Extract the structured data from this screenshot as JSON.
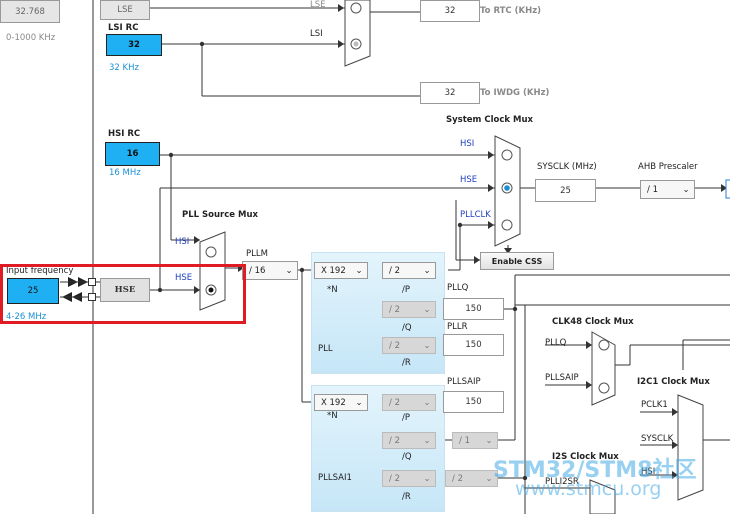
{
  "lse_label": "LSE",
  "lse_top_value": "32.768",
  "lse_range": "0-1000 KHz",
  "lsi_rc": {
    "title": "LSI RC",
    "value": "32",
    "unit": "32 KHz"
  },
  "rtc": {
    "value": "32",
    "label": "To RTC (KHz)"
  },
  "iwdg": {
    "value": "32",
    "label": "To IWDG (KHz)"
  },
  "hsi_rc": {
    "title": "HSI RC",
    "value": "16",
    "unit": "16 MHz"
  },
  "system_clock_mux": {
    "title": "System Clock Mux",
    "hsi": "HSI",
    "hse": "HSE",
    "pllclk": "PLLCLK"
  },
  "sysclk": {
    "label": "SYSCLK (MHz)",
    "value": "25"
  },
  "ahb": {
    "label": "AHB Prescaler",
    "value": "/ 1"
  },
  "enable_css": "Enable CSS",
  "pll_source_mux": {
    "title": "PLL Source Mux",
    "hsi": "HSI",
    "hse": "HSE"
  },
  "pllm": {
    "label": "PLLM",
    "value": "/ 16"
  },
  "input_frequency": {
    "label": "Input frequency",
    "value": "25",
    "range": "4-26 MHz"
  },
  "hse_block": "HSE",
  "pll": {
    "n_value": "X 192",
    "n_label": "*N",
    "name": "PLL",
    "p_value": "/ 2",
    "p_label": "/P",
    "q_value": "/ 2",
    "q_label": "/Q",
    "r_value": "/ 2",
    "r_label": "/R",
    "pllq_label": "PLLQ",
    "pllq_value": "150",
    "pllr_label": "PLLR",
    "pllr_value": "150"
  },
  "pllsai1": {
    "n_value": "X 192",
    "n_label": "*N",
    "name": "PLLSAI1",
    "p_value": "/ 2",
    "p_label": "/P",
    "q_value": "/ 2",
    "q_label": "/Q",
    "q2_value": "/ 1",
    "r_value": "/ 2",
    "r_label": "/R",
    "r2_value": "/ 2",
    "pllsaip_label": "PLLSAIP",
    "pllsaip_value": "150"
  },
  "clk48_mux": {
    "title": "CLK48 Clock Mux",
    "pllq": "PLLQ",
    "pllsaip": "PLLSAIP"
  },
  "i2c1_mux": {
    "title": "I2C1 Clock Mux",
    "pclk1": "PCLK1",
    "sysclk": "SYSCLK",
    "hsi": "HSI"
  },
  "i2s_mux": {
    "title": "I2S Clock Mux",
    "plli2sr": "PLLI2SR"
  },
  "watermark": {
    "line1": "STM32/STM8社区",
    "line2": "www.stmcu.org"
  },
  "colors": {
    "accent": "#1fb0f3",
    "highlight": "#e01b24",
    "label_blue": "#1a8fd6"
  }
}
